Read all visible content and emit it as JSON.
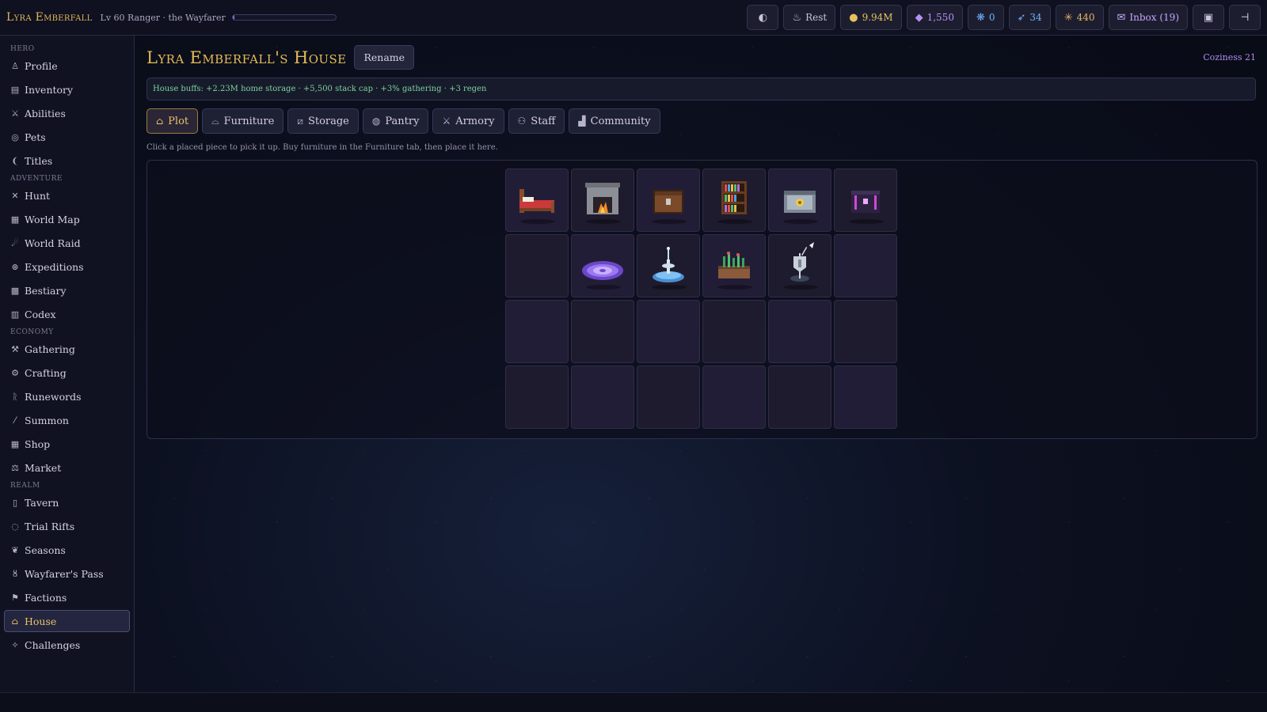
{
  "topbar": {
    "hero_name": "Lyra Emberfall",
    "hero_sub": "Lv 60 Ranger · the Wayfarer",
    "xp_progress": 0.02,
    "rest_label": "Rest",
    "gold": "9.94M",
    "gems": "1,550",
    "shards": "0",
    "feathers": "34",
    "sparks": "440",
    "inbox_label": "Inbox (19)"
  },
  "sidebar": {
    "sections": {
      "hero": "HERO",
      "adventure": "ADVENTURE",
      "economy": "ECONOMY",
      "realm": "REALM"
    },
    "hero_items": [
      "Profile",
      "Inventory",
      "Abilities",
      "Pets",
      "Titles"
    ],
    "adventure_items": [
      "Hunt",
      "World Map",
      "World Raid",
      "Expeditions",
      "Bestiary",
      "Codex"
    ],
    "economy_items": [
      "Gathering",
      "Crafting",
      "Runewords",
      "Summon",
      "Shop",
      "Market"
    ],
    "realm_items": [
      "Tavern",
      "Trial Rifts",
      "Seasons",
      "Wayfarer's Pass",
      "Factions",
      "House",
      "Challenges"
    ],
    "active": "House"
  },
  "main": {
    "title": "Lyra Emberfall's House",
    "rename_label": "Rename",
    "coziness": "Coziness 21",
    "buffs": "House buffs: +2.23M home storage · +5,500 stack cap · +3% gathering · +3 regen",
    "tabs": [
      "Plot",
      "Furniture",
      "Storage",
      "Pantry",
      "Armory",
      "Staff",
      "Community"
    ],
    "active_tab": "Plot",
    "hint": "Click a placed piece to pick it up. Buy furniture in the Furniture tab, then place it here.",
    "plot": {
      "columns": 6,
      "rows": 4,
      "cells": [
        "bed",
        "fireplace",
        "chest",
        "bookshelf",
        "vault",
        "arcane-chest",
        "",
        "rune-rug",
        "fountain",
        "planter",
        "banner-stand",
        "",
        "",
        "",
        "",
        "",
        "",
        "",
        "",
        "",
        "",
        "",
        "",
        ""
      ]
    }
  },
  "colors": {
    "accent_gold": "#e6bb55",
    "buff_green": "#7fd39a",
    "coziness_violet": "#b18cf2"
  }
}
